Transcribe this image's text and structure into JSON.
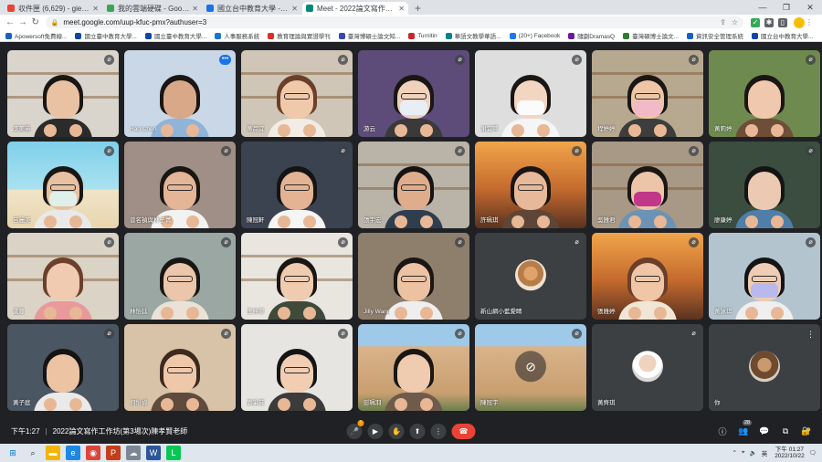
{
  "browser": {
    "tabs": [
      {
        "title": "収件匣 (6,629) - giee@gm.ntcu.edu.tw",
        "color": "#ea4335"
      },
      {
        "title": "我的雲端硬碟 - Google 雲端硬碟",
        "color": "#34a853"
      },
      {
        "title": "國立台中教育大學 - 日溫 - 活動日誌",
        "color": "#1a73e8"
      },
      {
        "title": "Meet - 2022論文寫作工作坊",
        "color": "#00897b",
        "active": true
      }
    ],
    "new_tab": "+",
    "url": "meet.google.com/uup-kfuc-pmx?authuser=3",
    "win_controls": [
      "—",
      "❐",
      "✕"
    ]
  },
  "bookmarks": [
    {
      "label": "Apowersoft免費線...",
      "color": "#1565c0"
    },
    {
      "label": "國立臺中教育大學...",
      "color": "#0d47a1"
    },
    {
      "label": "國立臺中教育大學...",
      "color": "#0d47a1"
    },
    {
      "label": "人事服務系統",
      "color": "#1976d2"
    },
    {
      "label": "教育理論與實證學刊",
      "color": "#d93025"
    },
    {
      "label": "臺灣博碩士論文知...",
      "color": "#3949ab"
    },
    {
      "label": "Turnitin",
      "color": "#c62828"
    },
    {
      "label": "華語文教學華語...",
      "color": "#00838f"
    },
    {
      "label": "(20+) Facebook",
      "color": "#1877f2"
    },
    {
      "label": "隨劇DramasQ",
      "color": "#6a1b9a"
    },
    {
      "label": "臺灣碩博士論文...",
      "color": "#2e7d32"
    },
    {
      "label": "資訊安全管理系統",
      "color": "#1565c0"
    },
    {
      "label": "國立台中教育大學...",
      "color": "#0d47a1"
    }
  ],
  "participants": [
    {
      "name": "李美英",
      "bg": "#d9d4cc",
      "skin": "#e9c2a4",
      "shirt": "#2b2b2b",
      "hair": "#1a1614",
      "glasses": false,
      "mask": false,
      "shelf": true
    },
    {
      "name": "Hao Chen",
      "bg": "#c9d7e6",
      "skin": "#d9a888",
      "shirt": "#8fb3d9",
      "hair": "#1a1614",
      "glasses": false,
      "mask": false,
      "more": true
    },
    {
      "name": "黃品宜",
      "bg": "#cfc6b7",
      "skin": "#f0c9ab",
      "shirt": "#f2ece4",
      "hair": "#6b3f2a",
      "glasses": true,
      "mask": false,
      "shelf": true
    },
    {
      "name": "游云",
      "bg": "#5d4c7a",
      "skin": "#f0d2bc",
      "shirt": "#3a3a3a",
      "hair": "#1a1614",
      "glasses": true,
      "mask": true,
      "maskColor": "#e7eef5"
    },
    {
      "name": "謝宜萍",
      "bg": "#dedede",
      "skin": "#f2d6c2",
      "shirt": "#f5f5f5",
      "hair": "#1a1614",
      "glasses": false,
      "mask": true,
      "maskColor": "#fbfbfb"
    },
    {
      "name": "程婷婷",
      "bg": "#b7a890",
      "skin": "#eec6a6",
      "shirt": "#3d3d3d",
      "hair": "#1a1614",
      "glasses": true,
      "mask": true,
      "maskColor": "#f2b9c8",
      "shelf": true
    },
    {
      "name": "黃莉婷",
      "bg": "#6f8a4e",
      "skin": "#f0c8ad",
      "shirt": "#6f4e37",
      "hair": "#1a1614",
      "glasses": false,
      "mask": false
    },
    {
      "name": "呂麗美",
      "bg": "#7cc5d9",
      "skin": "#e7c1a2",
      "shirt": "#e9e9e9",
      "hair": "#1a1614",
      "glasses": true,
      "mask": true,
      "maskColor": "#dff0ea",
      "beach": true
    },
    {
      "name": "曾名禎與林子菁",
      "bg": "#a08f86",
      "skin": "#e4b596",
      "shirt": "#f2f2f2",
      "hair": "#1a1614",
      "glasses": true,
      "mask": false
    },
    {
      "name": "陳冠軒",
      "bg": "#3b4250",
      "skin": "#e3b394",
      "shirt": "#f5f5f5",
      "hair": "#141414",
      "glasses": true,
      "mask": false
    },
    {
      "name": "張宇宏",
      "bg": "#b9b3a8",
      "skin": "#e0ad8c",
      "shirt": "#2f3e4f",
      "hair": "#141414",
      "glasses": true,
      "mask": false,
      "shelf": true
    },
    {
      "name": "許珮琪",
      "bg": "#c46a2e",
      "skin": "#e7b99a",
      "shirt": "#5d4636",
      "hair": "#1a1614",
      "glasses": true,
      "mask": false,
      "sunset": true
    },
    {
      "name": "吳雅君",
      "bg": "#a89886",
      "skin": "#ecc5a8",
      "shirt": "#6b93b5",
      "hair": "#1a1614",
      "glasses": false,
      "mask": true,
      "maskColor": "#c2378a",
      "shelf": true
    },
    {
      "name": "廖康婷",
      "bg": "#3a4d3f",
      "skin": "#ecc9b1",
      "shirt": "#4f7ea8",
      "hair": "#141414",
      "glasses": false,
      "mask": false
    },
    {
      "name": "盧蔓",
      "bg": "#dad3c6",
      "skin": "#f0cbb1",
      "shirt": "#e89a9a",
      "hair": "#6b3f2a",
      "glasses": false,
      "mask": false,
      "shelf": true
    },
    {
      "name": "林怡廷",
      "bg": "#9aa7a2",
      "skin": "#ecc6aa",
      "shirt": "#eae2d6",
      "hair": "#1a1614",
      "glasses": true,
      "mask": false
    },
    {
      "name": "王梓寧",
      "bg": "#e9e6df",
      "skin": "#efcbb0",
      "shirt": "#3f4a3b",
      "hair": "#1a1614",
      "glasses": true,
      "mask": false,
      "shelf": true
    },
    {
      "name": "Jilly Wang",
      "bg": "#8e7e6c",
      "skin": "#ecc2a3",
      "shirt": "#eeeeee",
      "hair": "#1a1614",
      "glasses": true,
      "mask": false
    },
    {
      "name": "新山網小藍愛睛",
      "avatar": "cat",
      "bg": "#3c4043"
    },
    {
      "name": "張雅婷",
      "bg": "#7a5a3f",
      "skin": "#efc7a6",
      "shirt": "#f1e6d6",
      "hair": "#6b3f2a",
      "glasses": true,
      "mask": false,
      "sunset": true
    },
    {
      "name": "黃詠琪",
      "bg": "#b4c4cf",
      "skin": "#efcdb4",
      "shirt": "#efefef",
      "hair": "#141414",
      "glasses": true,
      "mask": true,
      "maskColor": "#b9b9ee"
    },
    {
      "name": "黃子庭",
      "bg": "#4b5663",
      "skin": "#ecc3a3",
      "shirt": "#eaeaea",
      "hair": "#141414",
      "glasses": false,
      "mask": false
    },
    {
      "name": "何怡貞",
      "bg": "#d9c3a8",
      "skin": "#efc8aa",
      "shirt": "#5e4b3e",
      "hair": "#3d2a1f",
      "glasses": true,
      "mask": false
    },
    {
      "name": "劉采芸",
      "bg": "#e7e5e1",
      "skin": "#f1cdb2",
      "shirt": "#3b3b3b",
      "hair": "#141414",
      "glasses": true,
      "mask": false
    },
    {
      "name": "彭珮羽",
      "bg": "#d8b79a",
      "skin": "#efcbb0",
      "shirt": "#6f5b4b",
      "hair": "#1a1614",
      "glasses": false,
      "mask": false,
      "building": true
    },
    {
      "name": "陳冠宇",
      "bg": "#d9b68b",
      "camoff": true,
      "building": true
    },
    {
      "name": "黃齊琪",
      "avatar": "mask",
      "bg": "#3c4043"
    },
    {
      "name": "你",
      "avatar": "monkey",
      "bg": "#3c4043",
      "kebab": true
    }
  ],
  "meeting": {
    "time": "下午1:27",
    "title": "2022論文寫作工作坊(第3場次)陳孝賢老師",
    "participant_count": "28"
  },
  "taskbar": {
    "time": "下午 01:27",
    "date": "2022/10/22",
    "ime": "英"
  },
  "colors": {
    "meet_bg": "#202124",
    "button": "#3c4043",
    "hang_up": "#ea4335",
    "accent": "#1a73e8"
  }
}
